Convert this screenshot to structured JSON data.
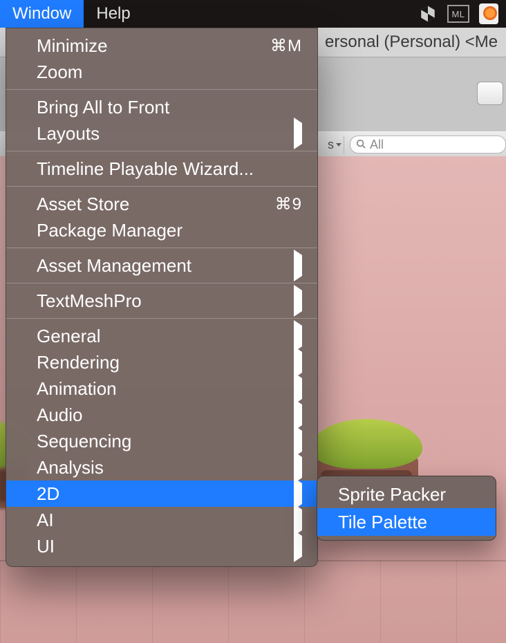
{
  "colors": {
    "accent": "#1f7cff",
    "menubar_bg": "#1a1615",
    "dropdown_bg": "#746763"
  },
  "menubar": {
    "items": [
      {
        "label": "Window",
        "active": true
      },
      {
        "label": "Help",
        "active": false
      }
    ],
    "tray": {
      "unity_icon": "unity-logo-icon",
      "ml_label": "ML",
      "account_icon": "account-key-icon"
    }
  },
  "window_title": "ersonal (Personal) <Me",
  "toolbar": {
    "dropdown_visible_suffix": "s",
    "search_placeholder": "All"
  },
  "window_menu": {
    "groups": [
      [
        {
          "label": "Minimize",
          "shortcut": "⌘M"
        },
        {
          "label": "Zoom"
        }
      ],
      [
        {
          "label": "Bring All to Front"
        },
        {
          "label": "Layouts",
          "submenu": true
        }
      ],
      [
        {
          "label": "Timeline Playable Wizard..."
        }
      ],
      [
        {
          "label": "Asset Store",
          "shortcut": "⌘9"
        },
        {
          "label": "Package Manager"
        }
      ],
      [
        {
          "label": "Asset Management",
          "submenu": true
        }
      ],
      [
        {
          "label": "TextMeshPro",
          "submenu": true
        }
      ],
      [
        {
          "label": "General",
          "submenu": true
        },
        {
          "label": "Rendering",
          "submenu": true
        },
        {
          "label": "Animation",
          "submenu": true
        },
        {
          "label": "Audio",
          "submenu": true
        },
        {
          "label": "Sequencing",
          "submenu": true
        },
        {
          "label": "Analysis",
          "submenu": true
        },
        {
          "label": "2D",
          "submenu": true,
          "highlight": true
        },
        {
          "label": "AI",
          "submenu": true
        },
        {
          "label": "UI",
          "submenu": true
        }
      ]
    ]
  },
  "submenu_2d": {
    "items": [
      {
        "label": "Sprite Packer"
      },
      {
        "label": "Tile Palette",
        "highlight": true
      }
    ]
  }
}
